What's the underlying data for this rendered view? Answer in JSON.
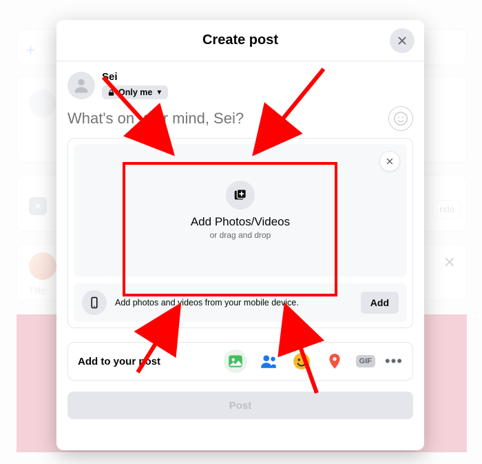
{
  "modal": {
    "title": "Create post",
    "close_icon": "close-icon"
  },
  "user": {
    "name": "Sei",
    "privacy_label": "Only me"
  },
  "composer": {
    "placeholder": "What's on your mind, Sei?"
  },
  "dropzone": {
    "title": "Add Photos/Videos",
    "subtitle": "or drag and drop"
  },
  "mobile_upload": {
    "text": "Add photos and videos from your mobile device.",
    "button": "Add"
  },
  "add_to_post": {
    "label": "Add to your post",
    "gif_label": "GIF"
  },
  "post_button": "Post",
  "background": {
    "title_label": "Title:",
    "undo_btn": "ndo"
  }
}
